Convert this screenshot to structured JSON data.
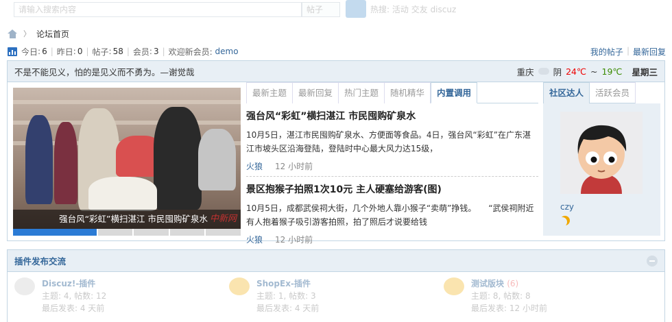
{
  "topbar": {
    "search_placeholder": "请输入搜索内容",
    "search_type": "帖子",
    "hot_label": "热搜:",
    "hot_items": [
      "活动",
      "交友",
      "discuz"
    ]
  },
  "breadcrumb": {
    "current": "论坛首页"
  },
  "stats": {
    "today_label": "今日",
    "today_value": "6",
    "yesterday_label": "昨日",
    "yesterday_value": "0",
    "posts_label": "帖子",
    "posts_value": "58",
    "members_label": "会员",
    "members_value": "3",
    "welcome_label": "欢迎新会员:",
    "new_member": "demo",
    "my_posts": "我的帖子",
    "latest_replies": "最新回复"
  },
  "motto": {
    "text": "不是不能见义，怕的是见义而不勇为。—谢觉哉",
    "city": "重庆",
    "weather": "阴",
    "temp_high": "24℃",
    "temp_sep": "~",
    "temp_low": "19℃",
    "weekday": "星期三"
  },
  "slider": {
    "caption": "强台风“彩虹”横扫湛江 市民囤购矿泉水",
    "watermark": "中新网"
  },
  "tabs": [
    "最新主题",
    "最新回复",
    "热门主题",
    "随机精华",
    "内置调用"
  ],
  "active_tab": "内置调用",
  "articles": [
    {
      "title": "强台风“彩虹”横扫湛江 市民囤购矿泉水",
      "summary": "10月5日，湛江市民囤购矿泉水、方便面等食品。4日，强台风“彩虹”在广东湛江市坡头区沿海登陆，登陆时中心最大风力达15级，",
      "author": "火狼",
      "time": "12 小时前"
    },
    {
      "title": "景区抱猴子拍照1次10元 主人硬塞给游客(图)",
      "summary": "10月5日，成都武侯祠大街，几个外地人靠小猴子“卖萌”挣钱。　　“武侯祠附近有人抱着猴子吸引游客拍照，拍了照后才说要给钱",
      "author": "火狼",
      "time": "12 小时前"
    }
  ],
  "right_tabs": [
    "社区达人",
    "活跃会员"
  ],
  "active_right_tab": "社区达人",
  "featured_user": {
    "name": "czy"
  },
  "plugin": {
    "title": "插件发布交流",
    "forums": [
      {
        "name": "Discuz!-插件",
        "today": "",
        "stats": "主题: 4, 帖数: 12",
        "last": "最后发表: 4 天前"
      },
      {
        "name": "ShopEx-插件",
        "today": "",
        "stats": "主题: 1, 帖数: 3",
        "last": "最后发表: 4 天前"
      },
      {
        "name": "测试版块",
        "today": "(6)",
        "stats": "主题: 8, 帖数: 8",
        "last": "最后发表: 12 小时前"
      }
    ]
  },
  "colors": {
    "link": "#336699",
    "panel_bg": "#e8eff5",
    "border": "#c2d5e3",
    "slider_active": "#2b7bd5",
    "temp_high": "#ee0000",
    "temp_low": "#3a8a00"
  }
}
